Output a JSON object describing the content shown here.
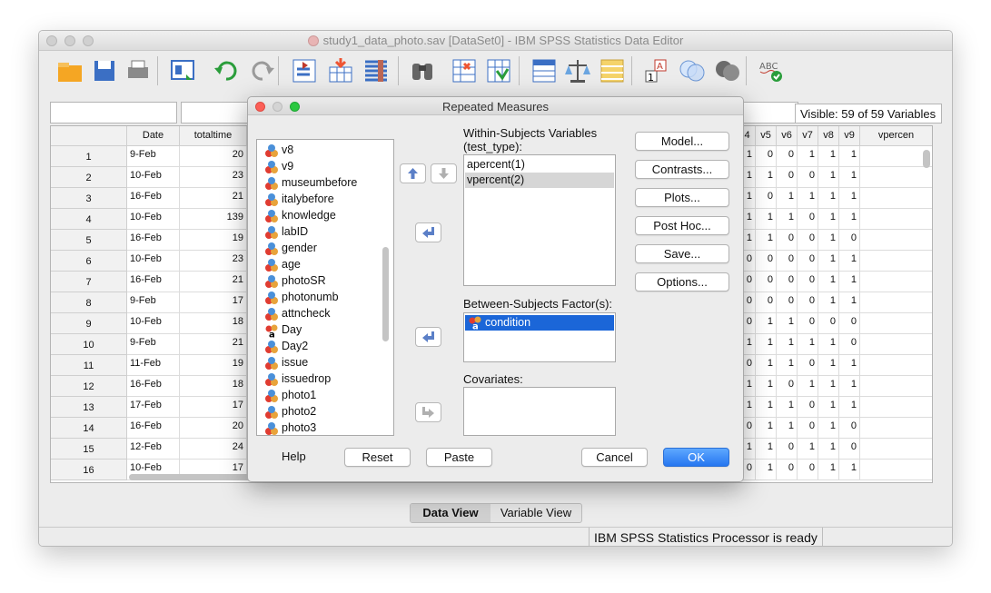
{
  "main_window": {
    "title": "study1_data_photo.sav [DataSet0] - IBM SPSS Statistics Data Editor",
    "visible_label": "Visible: 59 of 59 Variables",
    "status": "IBM SPSS Statistics Processor is ready",
    "tabs": {
      "data_view": "Data View",
      "variable_view": "Variable View"
    },
    "toolbar_icons": [
      "open-folder-icon",
      "save-icon",
      "print-icon",
      "dialog-recall-icon",
      "undo-icon",
      "redo-icon",
      "go-to-case-icon",
      "go-to-variable-icon",
      "variables-icon",
      "find-icon",
      "insert-cases-icon",
      "insert-variable-icon",
      "split-file-icon",
      "weight-cases-icon",
      "select-cases-icon",
      "value-labels-icon",
      "use-sets-icon",
      "show-all-variables-icon",
      "spell-check-icon"
    ]
  },
  "grid": {
    "left_columns": [
      "Date",
      "totaltime"
    ],
    "right_columns": [
      "4",
      "v5",
      "v6",
      "v7",
      "v8",
      "v9",
      "vpercen"
    ],
    "rows": [
      {
        "n": "1",
        "date": "9-Feb",
        "time": "20",
        "v": [
          "1",
          "0",
          "0",
          "1",
          "1",
          "1"
        ]
      },
      {
        "n": "2",
        "date": "10-Feb",
        "time": "23",
        "v": [
          "1",
          "1",
          "0",
          "0",
          "1",
          "1"
        ]
      },
      {
        "n": "3",
        "date": "16-Feb",
        "time": "21",
        "v": [
          "1",
          "0",
          "1",
          "1",
          "1",
          "1"
        ]
      },
      {
        "n": "4",
        "date": "10-Feb",
        "time": "139",
        "v": [
          "1",
          "1",
          "1",
          "0",
          "1",
          "1"
        ]
      },
      {
        "n": "5",
        "date": "16-Feb",
        "time": "19",
        "v": [
          "1",
          "1",
          "0",
          "0",
          "1",
          "0"
        ]
      },
      {
        "n": "6",
        "date": "10-Feb",
        "time": "23",
        "v": [
          "0",
          "0",
          "0",
          "0",
          "1",
          "1"
        ]
      },
      {
        "n": "7",
        "date": "16-Feb",
        "time": "21",
        "v": [
          "0",
          "0",
          "0",
          "0",
          "1",
          "1"
        ]
      },
      {
        "n": "8",
        "date": "9-Feb",
        "time": "17",
        "v": [
          "0",
          "0",
          "0",
          "0",
          "1",
          "1"
        ]
      },
      {
        "n": "9",
        "date": "10-Feb",
        "time": "18",
        "v": [
          "0",
          "1",
          "1",
          "0",
          "0",
          "0"
        ]
      },
      {
        "n": "10",
        "date": "9-Feb",
        "time": "21",
        "v": [
          "1",
          "1",
          "1",
          "1",
          "1",
          "0"
        ]
      },
      {
        "n": "11",
        "date": "11-Feb",
        "time": "19",
        "v": [
          "0",
          "1",
          "1",
          "0",
          "1",
          "1"
        ]
      },
      {
        "n": "12",
        "date": "16-Feb",
        "time": "18",
        "v": [
          "1",
          "1",
          "0",
          "1",
          "1",
          "1"
        ]
      },
      {
        "n": "13",
        "date": "17-Feb",
        "time": "17",
        "v": [
          "1",
          "1",
          "1",
          "0",
          "1",
          "1"
        ]
      },
      {
        "n": "14",
        "date": "16-Feb",
        "time": "20",
        "v": [
          "0",
          "1",
          "1",
          "0",
          "1",
          "0"
        ]
      },
      {
        "n": "15",
        "date": "12-Feb",
        "time": "24",
        "v": [
          "1",
          "1",
          "0",
          "1",
          "1",
          "0"
        ]
      },
      {
        "n": "16",
        "date": "10-Feb",
        "time": "17",
        "v": [
          "0",
          "1",
          "0",
          "0",
          "1",
          "1"
        ]
      }
    ]
  },
  "dialog": {
    "title": "Repeated Measures",
    "variables": [
      {
        "name": "v8",
        "type": "scale"
      },
      {
        "name": "v9",
        "type": "scale"
      },
      {
        "name": "museumbefore",
        "type": "scale"
      },
      {
        "name": "italybefore",
        "type": "scale"
      },
      {
        "name": "knowledge",
        "type": "scale"
      },
      {
        "name": "labID",
        "type": "scale"
      },
      {
        "name": "gender",
        "type": "scale"
      },
      {
        "name": "age",
        "type": "scale"
      },
      {
        "name": "photoSR",
        "type": "scale"
      },
      {
        "name": "photonumb",
        "type": "scale"
      },
      {
        "name": "attncheck",
        "type": "scale"
      },
      {
        "name": "Day",
        "type": "string"
      },
      {
        "name": "Day2",
        "type": "scale"
      },
      {
        "name": "issue",
        "type": "scale"
      },
      {
        "name": "issuedrop",
        "type": "scale"
      },
      {
        "name": "photo1",
        "type": "scale"
      },
      {
        "name": "photo2",
        "type": "scale"
      },
      {
        "name": "photo3",
        "type": "scale"
      }
    ],
    "within_label": "Within-Subjects Variables",
    "within_sub": "(test_type):",
    "within_items": [
      "apercent(1)",
      "vpercent(2)"
    ],
    "between_label": "Between-Subjects Factor(s):",
    "between_items": [
      "condition"
    ],
    "covariates_label": "Covariates:",
    "side_buttons": [
      "Model...",
      "Contrasts...",
      "Plots...",
      "Post Hoc...",
      "Save...",
      "Options..."
    ],
    "bottom": {
      "help": "Help",
      "reset": "Reset",
      "paste": "Paste",
      "cancel": "Cancel",
      "ok": "OK"
    }
  }
}
